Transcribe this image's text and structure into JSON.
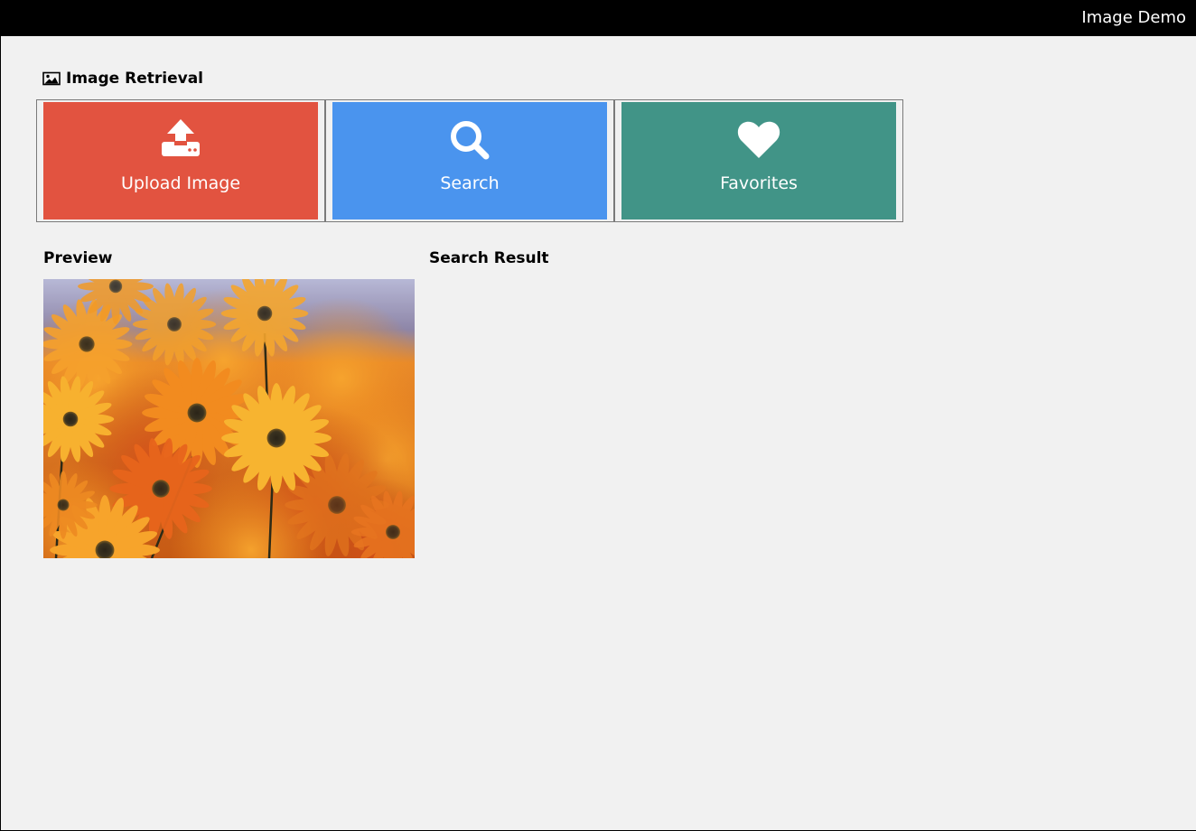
{
  "window": {
    "title": "Image Demo"
  },
  "section": {
    "title": "Image Retrieval",
    "icon": "image-icon"
  },
  "actions": [
    {
      "label": "Upload Image",
      "icon": "upload-icon",
      "color": "#e25340"
    },
    {
      "label": "Search",
      "icon": "search-icon",
      "color": "#4a94ee"
    },
    {
      "label": "Favorites",
      "icon": "heart-icon",
      "color": "#419487"
    }
  ],
  "preview": {
    "heading": "Preview",
    "image": "orange-daisy-flowers-photo"
  },
  "results": {
    "heading": "Search Result"
  }
}
